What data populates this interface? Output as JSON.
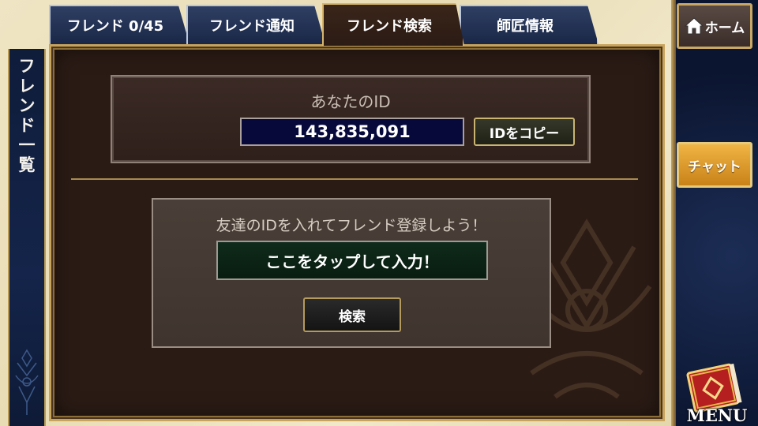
{
  "tabs": [
    {
      "label": "フレンド 0/45",
      "active": false
    },
    {
      "label": "フレンド通知",
      "active": false
    },
    {
      "label": "フレンド検索",
      "active": true
    },
    {
      "label": "師匠情報",
      "active": false
    }
  ],
  "side_title": [
    "フ",
    "レ",
    "ン",
    "ド",
    "一",
    "覧"
  ],
  "id_section": {
    "label": "あなたのID",
    "value": "143,835,091",
    "copy_button": "IDをコピー"
  },
  "search_section": {
    "prompt": "友達のIDを入れてフレンド登録しよう！",
    "input_placeholder": "ここをタップして入力！",
    "search_button": "検索"
  },
  "nav": {
    "home": "ホーム",
    "chat": "チャット",
    "menu": "MENU"
  },
  "icons": {
    "home": "house-icon",
    "menu": "book-icon"
  },
  "colors": {
    "accent_gold": "#c7a35b",
    "chat_orange": "#e59d2e",
    "panel_bg": "#2b1b15",
    "id_field_bg": "#07093a"
  }
}
